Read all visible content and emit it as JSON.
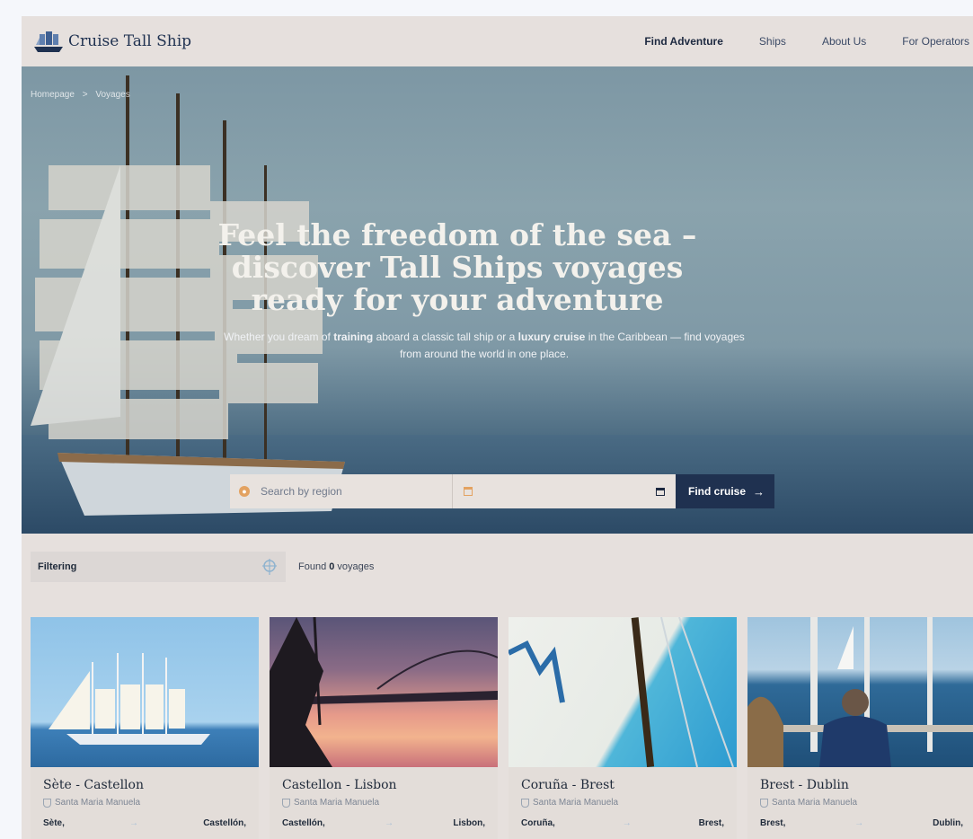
{
  "header": {
    "brand": "Cruise Tall Ship",
    "nav": [
      {
        "label": "Find Adventure",
        "active": true
      },
      {
        "label": "Ships",
        "active": false
      },
      {
        "label": "About Us",
        "active": false
      },
      {
        "label": "For Operators",
        "active": false
      }
    ]
  },
  "breadcrumb": {
    "home": "Homepage",
    "separator": ">",
    "current": "Voyages"
  },
  "hero": {
    "title": "Feel the freedom of the sea – discover Tall Ships voyages ready for your adventure",
    "sub_1": "Whether you dream of ",
    "sub_b1": "training",
    "sub_2": " aboard a classic tall ship or a ",
    "sub_b2": "luxury cruise",
    "sub_3": " in the Caribbean — find voyages from around the world in one place."
  },
  "search": {
    "region_placeholder": "Search by region",
    "find_label": "Find cruise",
    "find_arrow": "→"
  },
  "filter": {
    "label": "Filtering"
  },
  "results": {
    "prefix": "Found ",
    "count": "0",
    "suffix": " voyages"
  },
  "cards": [
    {
      "title": "Sète - Castellon",
      "ship": "Santa Maria Manuela",
      "from": "Sète,",
      "to": "Castellón,"
    },
    {
      "title": "Castellon - Lisbon",
      "ship": "Santa Maria Manuela",
      "from": "Castellón,",
      "to": "Lisbon,"
    },
    {
      "title": "Coruña - Brest",
      "ship": "Santa Maria Manuela",
      "from": "Coruña,",
      "to": "Brest,"
    },
    {
      "title": "Brest - Dublin",
      "ship": "Santa Maria Manuela",
      "from": "Brest,",
      "to": "Dublin,"
    }
  ],
  "colors": {
    "primary": "#1f3150",
    "accent": "#e3a261",
    "background": "#e6e0dd"
  }
}
